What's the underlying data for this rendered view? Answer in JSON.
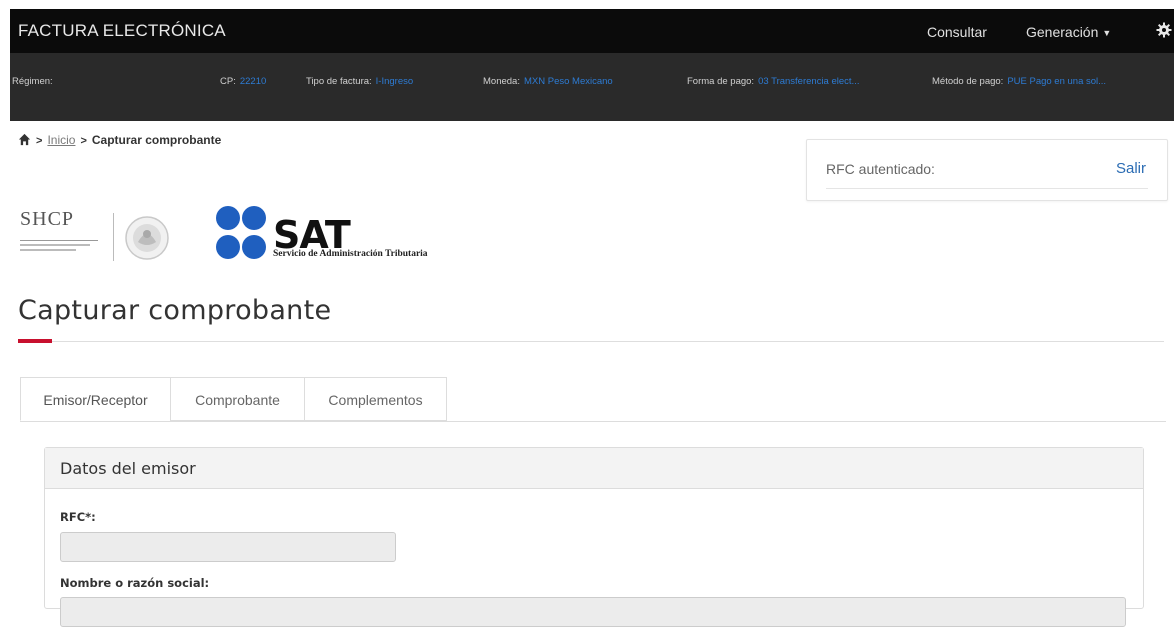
{
  "header": {
    "app_title": "FACTURA ELECTRÓNICA",
    "nav": {
      "consultar": "Consultar",
      "generacion": "Generación"
    }
  },
  "info_bar": {
    "regimen_label": "Régimen:",
    "cp_label": "CP:",
    "cp_value": "22210",
    "tipo_label": "Tipo de factura:",
    "tipo_value": "I-Ingreso",
    "moneda_label": "Moneda:",
    "moneda_value": "MXN Peso Mexicano",
    "forma_label": "Forma de pago:",
    "forma_value": "03 Transferencia elect...",
    "metodo_label": "Método de pago:",
    "metodo_value": "PUE Pago en una sol..."
  },
  "breadcrumb": {
    "home_icon": "home-icon",
    "inicio": "Inicio",
    "current": "Capturar comprobante"
  },
  "auth_box": {
    "rfc_label": "RFC autenticado:",
    "salir": "Salir"
  },
  "logos": {
    "shcp": "SHCP",
    "sat": "SAT",
    "sat_subtitle": "Servicio de Administración Tributaria"
  },
  "page": {
    "title": "Capturar comprobante",
    "accent_color": "#c8102e"
  },
  "tabs": [
    {
      "label": "Emisor/Receptor",
      "active": true
    },
    {
      "label": "Comprobante",
      "active": false
    },
    {
      "label": "Complementos",
      "active": false
    }
  ],
  "emisor": {
    "section_title": "Datos del emisor",
    "rfc_label": "RFC*:",
    "rfc_value": "",
    "nombre_label": "Nombre o razón social:",
    "nombre_value": ""
  },
  "colors": {
    "topbar": "#0b0b0b",
    "infobar": "#2a2a2a",
    "link_blue": "#2d7bd3",
    "sat_blue": "#1f5fbf"
  }
}
